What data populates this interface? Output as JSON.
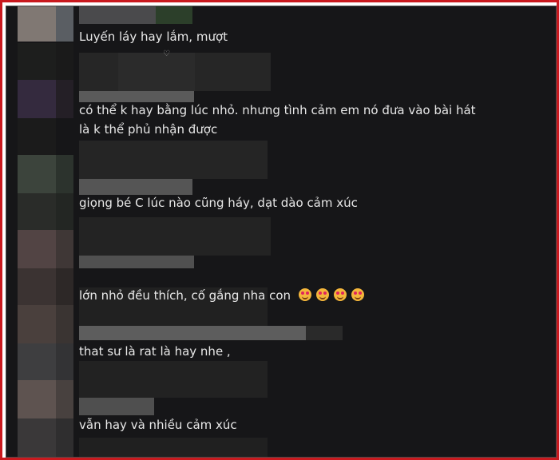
{
  "comments": [
    {
      "text": "Luyến láy hay lắm, mượt"
    },
    {
      "text": "có thể k hay bằng lúc nhỏ. nhưng tình cảm em nó đưa vào bài hát\nlà k thể phủ nhận được"
    },
    {
      "text": "giọng bé C lúc nào cũng háy, dạt dào cảm xúc"
    },
    {
      "text": "lớn nhỏ đều thích, cố gắng nha con",
      "emojis": [
        "smiling-face-with-hearts-icon",
        "smiling-face-with-hearts-icon",
        "smiling-face-with-hearts-icon",
        "smiling-face-with-hearts-icon"
      ]
    },
    {
      "text": "that sư là rat là hay nhe ,"
    },
    {
      "text": "vẫn hay và nhiều cảm xúc"
    }
  ],
  "colors": {
    "frame_border": "#c9191e",
    "background": "#161618",
    "text": "#e8e8e8"
  }
}
